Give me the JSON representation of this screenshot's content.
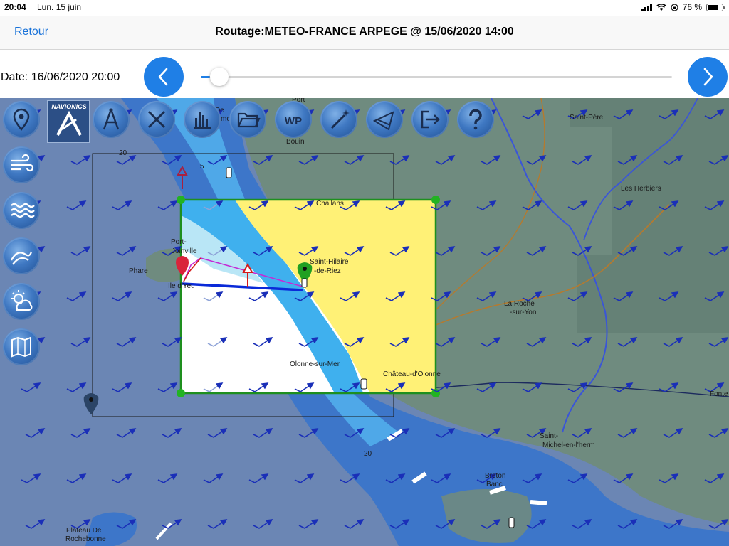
{
  "status_bar": {
    "time": "20:04",
    "date": "Lun. 15 juin",
    "battery": "76 %",
    "battery_level": 0.76
  },
  "nav": {
    "back_label": "Retour",
    "title": "Routage:METEO-FRANCE ARPEGE @ 15/06/2020 14:00"
  },
  "time_control": {
    "date_label": "Date: 16/06/2020 20:00",
    "slider_position": 0.02
  },
  "toolbar": {
    "navionics_logo": "NAVIONICS",
    "top_icons": [
      "map-pin-icon",
      "compass-icon",
      "close-icon",
      "bar-chart-icon",
      "folder-icon",
      "waypoint-icon",
      "magic-wand-icon",
      "routing-icon",
      "exit-icon",
      "help-icon"
    ],
    "waypoint_label": "WP",
    "side_icons": [
      "wind-icon",
      "waves-icon",
      "current-icon",
      "weather-icon",
      "chart-icon"
    ]
  },
  "map": {
    "labels": {
      "port": "Port",
      "de": "De",
      "mo": "mo",
      "bouin": "Bouin",
      "saint_pere": "Saint-Père",
      "les_herbiers": "Les Herbiers",
      "challans": "Challans",
      "port_joinville_1": "Port-",
      "port_joinville_2": "Joinville",
      "phare": "Phare",
      "ile_dyeu": "Ile d'Yeu",
      "saint_hilaire_1": "Saint-Hilaire",
      "saint_hilaire_2": "-de-Riez",
      "la_roche_1": "La Roche",
      "la_roche_2": "-sur-Yon",
      "olonne": "Olonne-sur-Mer",
      "chateau": "Château-d'Olonne",
      "fonte": "Fonte",
      "saint_michel_1": "Saint-",
      "saint_michel_2": "Michel-en-l'herm",
      "breton_1": "Breton",
      "breton_2": "Banc",
      "plateau_1": "Plateau De",
      "plateau_2": "Rochebonne",
      "depth_20a": "20",
      "depth_5": "5",
      "depth_20b": "20"
    },
    "colors": {
      "sea_deep": "#6b86b4",
      "sea_shelf": "#3d76c9",
      "land": "#6f8b7f",
      "zone_yellow": "#fff176",
      "zone_border": "#1e8f1e",
      "route": "#0a2ad8",
      "route_alt": "#c42ad6",
      "wind_arrow": "#1a2fb8"
    }
  }
}
